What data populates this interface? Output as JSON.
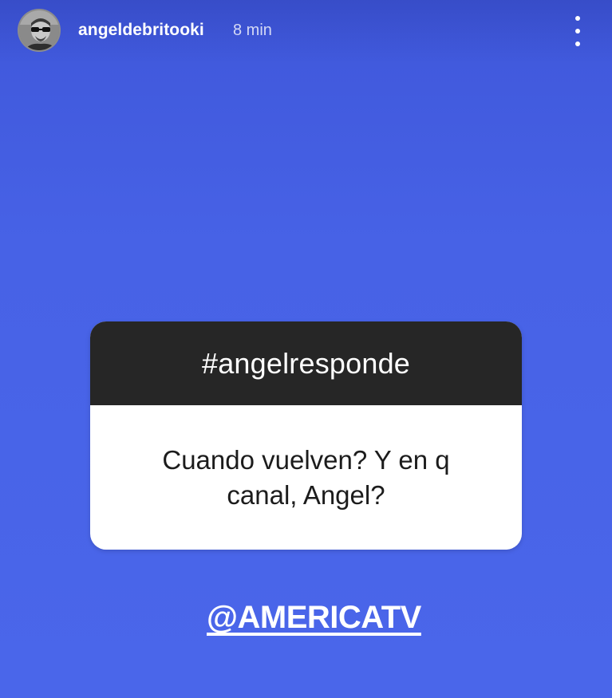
{
  "story": {
    "background_color": "#4a62e8",
    "header": {
      "username": "angeldebritooki",
      "time_ago": "8 min",
      "avatar": "profile-photo",
      "menu_icon": "more-vertical-icon"
    },
    "question_sticker": {
      "title": "#angelresponde",
      "question": "Cuando vuelven? Y en q canal, Angel?"
    },
    "mention": "@AMERICATV"
  }
}
